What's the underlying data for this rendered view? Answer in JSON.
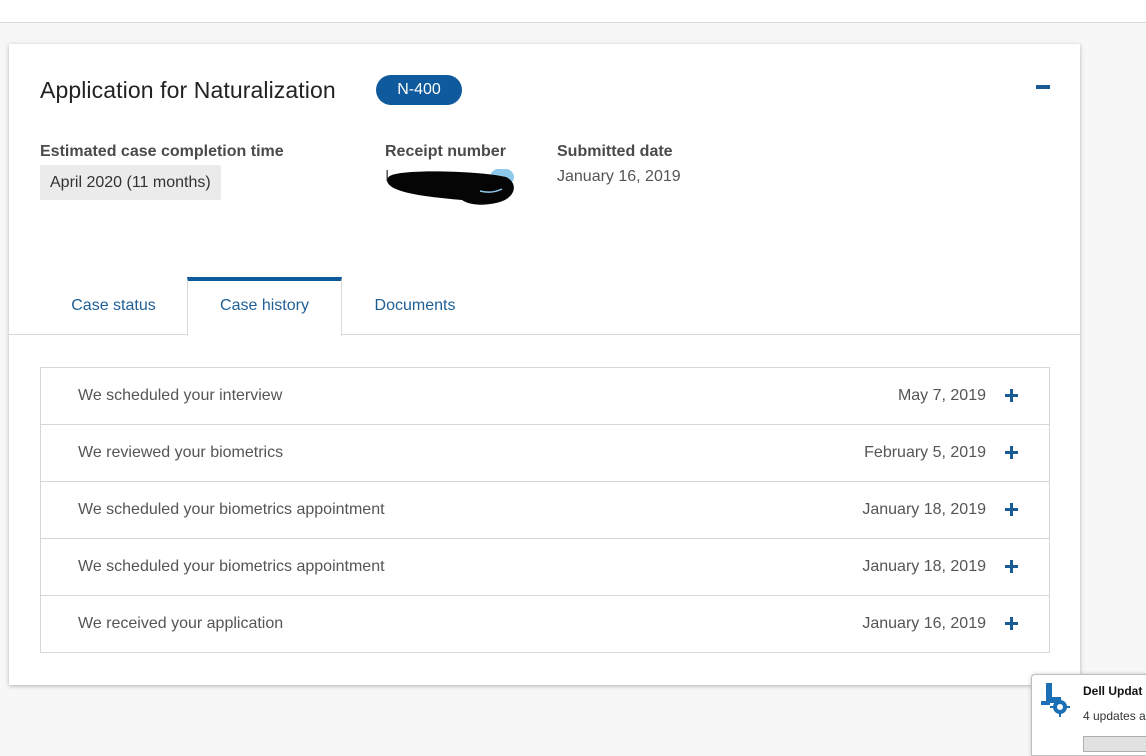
{
  "case": {
    "title": "Application for Naturalization",
    "form_badge": "N-400"
  },
  "details": {
    "estimated_label": "Estimated case completion time",
    "estimated_value": "April 2020 (11 months)",
    "receipt_label": "Receipt number",
    "receipt_value_visible": "I",
    "submitted_label": "Submitted date",
    "submitted_value": "January 16, 2019"
  },
  "tabs": [
    {
      "label": "Case status"
    },
    {
      "label": "Case history"
    },
    {
      "label": "Documents"
    }
  ],
  "active_tab": "Case history",
  "history": [
    {
      "event": "We scheduled your interview",
      "date": "May 7, 2019"
    },
    {
      "event": "We reviewed your biometrics",
      "date": "February 5, 2019"
    },
    {
      "event": "We scheduled your biometrics appointment",
      "date": "January 18, 2019"
    },
    {
      "event": "We scheduled your biometrics appointment",
      "date": "January 18, 2019"
    },
    {
      "event": "We received your application",
      "date": "January 16, 2019"
    }
  ],
  "notification": {
    "title": "Dell Updat",
    "text": "4 updates a",
    "icon": "dell-update-icon"
  },
  "colors": {
    "accent": "#0e5a9c",
    "icon_blue": "#1a5b95",
    "text_gray": "#555555"
  }
}
